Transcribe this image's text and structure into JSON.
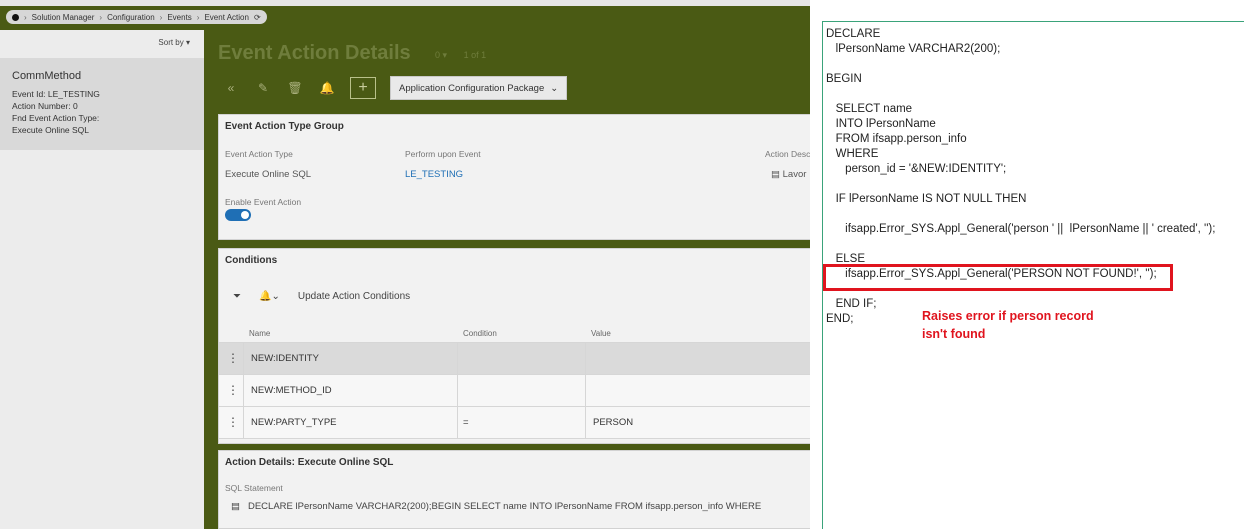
{
  "breadcrumb": [
    "Solution Manager",
    "Configuration",
    "Events",
    "Event Action"
  ],
  "left_panel": {
    "sort_label": "Sort by",
    "record": {
      "title": "CommMethod",
      "lines": [
        "Event Id:   LE_TESTING",
        "Action Number:   0",
        "Fnd Event Action Type:",
        "Execute Online SQL"
      ]
    }
  },
  "main": {
    "title": "Event Action Details",
    "count": "0",
    "pager": "1 of 1",
    "package_button": "Application Configuration Package"
  },
  "group1": {
    "title": "Event Action Type Group",
    "field1_label": "Event Action Type",
    "field1_value": "Execute Online SQL",
    "field2_label": "Perform upon Event",
    "field2_value": "LE_TESTING",
    "field3_label": "Action Desc",
    "field3_value": "Lavor",
    "toggle_label": "Enable Event Action"
  },
  "conditions": {
    "title": "Conditions",
    "update_button": "Update Action Conditions",
    "columns": [
      "Name",
      "Condition",
      "Value"
    ],
    "rows": [
      {
        "name": "NEW:IDENTITY",
        "condition": "",
        "value": ""
      },
      {
        "name": "NEW:METHOD_ID",
        "condition": "",
        "value": ""
      },
      {
        "name": "NEW:PARTY_TYPE",
        "condition": "=",
        "value": "PERSON"
      }
    ]
  },
  "action_details": {
    "title": "Action Details: Execute Online SQL",
    "sql_label": "SQL Statement",
    "sql_preview": "DECLARE   lPersonName VARCHAR2(200);BEGIN   SELECT name   INTO lPersonName   FROM ifsapp.person_info   WHERE"
  },
  "code_panel": {
    "code": "DECLARE\n   lPersonName VARCHAR2(200);\n\nBEGIN\n\n   SELECT name\n   INTO lPersonName\n   FROM ifsapp.person_info\n   WHERE\n      person_id = '&NEW:IDENTITY';\n\n   IF lPersonName IS NOT NULL THEN\n\n      ifsapp.Error_SYS.Appl_General('person ' ||  lPersonName || ' created', '');\n\n   ELSE\n      ifsapp.Error_SYS.Appl_General('PERSON NOT FOUND!', '');\n\n   END IF;\nEND;",
    "annotation": "Raises error if person record\nisn't found",
    "highlight_color": "#e0141e"
  }
}
